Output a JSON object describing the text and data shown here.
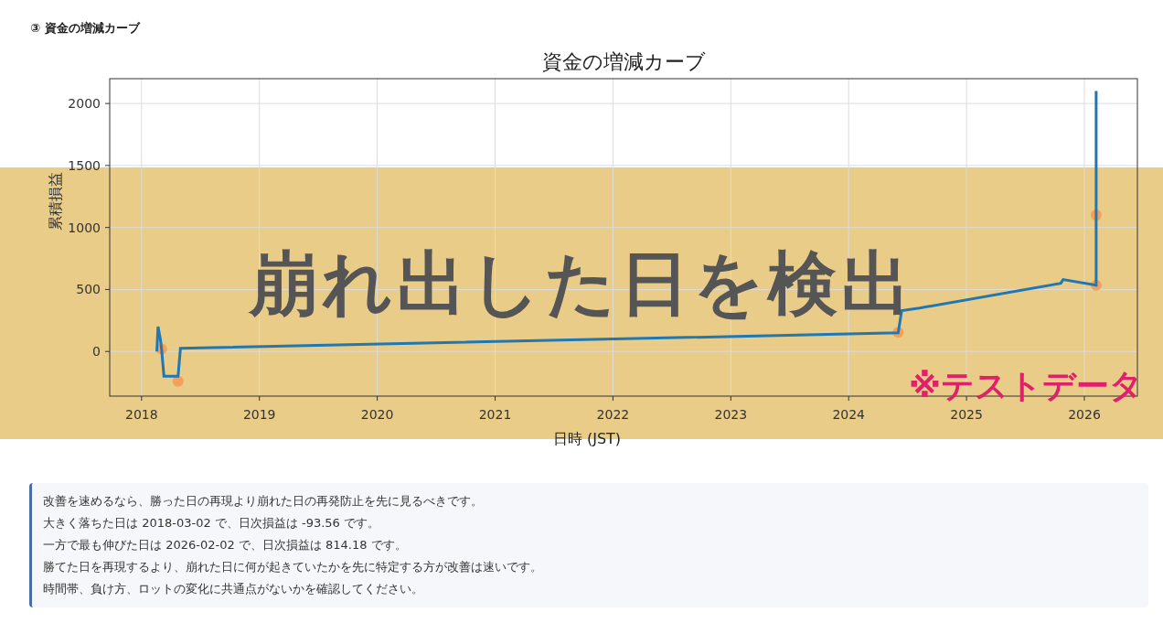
{
  "section_heading": "③ 資金の増減カーブ",
  "chart": {
    "chart_data": {
      "type": "line",
      "title": "資金の増減カーブ",
      "xlabel": "日時 (JST)",
      "ylabel": "累積損益",
      "xlim": [
        2017.73,
        2026.45
      ],
      "ylim": [
        -360,
        2200
      ],
      "grid": true,
      "xticks": [
        2018,
        2019,
        2020,
        2021,
        2022,
        2023,
        2024,
        2025,
        2026
      ],
      "yticks": [
        0,
        500,
        1000,
        1500,
        2000
      ],
      "x": [
        2018.13,
        2018.14,
        2018.16,
        2018.17,
        2018.19,
        2018.31,
        2018.33,
        2024.42,
        2024.45,
        2024.6,
        2025.8,
        2025.82,
        2026.1,
        2026.1,
        2026.1
      ],
      "series": [
        {
          "type": "line",
          "color": "#1f77b4",
          "values": [
            0,
            200,
            100,
            20,
            -200,
            -200,
            25,
            150,
            330,
            350,
            550,
            580,
            535,
            1100,
            2100
          ]
        },
        {
          "type": "scatter",
          "color": "#f5a05a",
          "values": [
            null,
            null,
            null,
            20,
            null,
            -240,
            null,
            155,
            null,
            null,
            null,
            null,
            535,
            1100,
            null
          ]
        }
      ]
    }
  },
  "banner": {
    "title": "崩れ出した日を検出",
    "note": "※テストデータ"
  },
  "summary": {
    "lines": [
      "改善を速めるなら、勝った日の再現より崩れた日の再発防止を先に見るべきです。",
      "大きく落ちた日は 2018-03-02 で、日次損益は -93.56 です。",
      "一方で最も伸びた日は 2026-02-02 で、日次損益は 814.18 です。",
      "勝てた日を再現するより、崩れた日に何が起きていたかを先に特定する方が改善は速いです。",
      "時間帯、負け方、ロットの変化に共通点がないかを確認してください。"
    ]
  }
}
